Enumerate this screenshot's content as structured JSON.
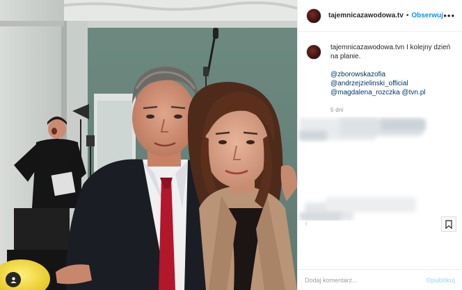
{
  "post": {
    "username": "tajemnicazawodowa.tv",
    "follow_label": "Obserwuj",
    "separator": "•",
    "more_icon": "more-options-icon",
    "caption": {
      "username": "tajemnicazawodowa.tvn",
      "text": "I kolejny dzień na planie.",
      "mentions": [
        "@zborowskazofia",
        "@andrzejzielinski_official",
        "@magdalena_rozczka @tvn.pl"
      ],
      "age": "5 dni"
    },
    "comment_placeholder": "Dodaj komentarz...",
    "publish_label": "Opublikuj",
    "tag_icon": "user-tag-icon",
    "bookmark_icon": "bookmark-icon",
    "colors": {
      "link": "#003569",
      "follow": "#0095f6",
      "publish_disabled": "#b2dffc",
      "tie": "#b3172b",
      "wall": "#6f8c82"
    }
  }
}
